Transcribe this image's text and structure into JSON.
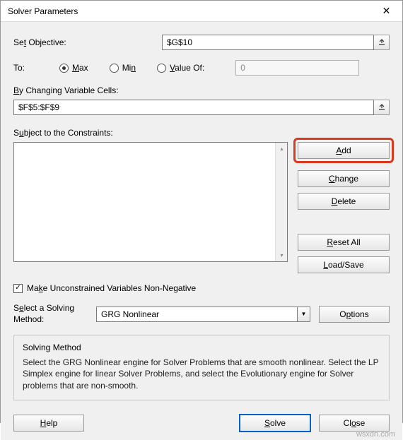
{
  "title": "Solver Parameters",
  "labels": {
    "set_objective": "Set Objective:",
    "to": "To:",
    "max": "Max",
    "min": "Min",
    "value_of": "Value Of:",
    "by_changing": "By Changing Variable Cells:",
    "subject_to": "Subject to the Constraints:",
    "make_unconstrained": "Make Unconstrained Variables Non-Negative",
    "select_method": "Select a Solving Method:"
  },
  "inputs": {
    "objective": "$G$10",
    "value_of": "0",
    "changing_cells": "$F$5:$F$9",
    "method_selected": "GRG Nonlinear"
  },
  "side_buttons": {
    "add": "Add",
    "change": "Change",
    "delete": "Delete",
    "reset": "Reset All",
    "load_save": "Load/Save"
  },
  "options_btn": "Options",
  "group": {
    "title": "Solving Method",
    "text": "Select the GRG Nonlinear engine for Solver Problems that are smooth nonlinear. Select the LP Simplex engine for linear Solver Problems, and select the Evolutionary engine for Solver problems that are non-smooth."
  },
  "footer": {
    "help": "Help",
    "solve": "Solve",
    "close": "Close"
  },
  "watermark": "wsxdn.com"
}
